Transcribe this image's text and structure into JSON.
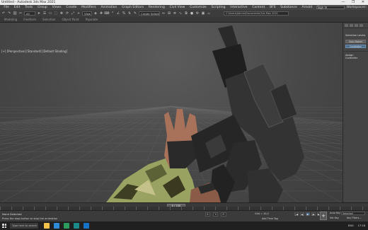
{
  "window": {
    "title": "Untitled - Autodesk 3ds Max 2021",
    "controls": [
      "—",
      "❐",
      "✕"
    ]
  },
  "menu": {
    "items": [
      "File",
      "Edit",
      "Tools",
      "Group",
      "Views",
      "Create",
      "Modifiers",
      "Animation",
      "Graph Editors",
      "Rendering",
      "Civil View",
      "Customize",
      "Scripting",
      "Interactive",
      "Content",
      "BFS",
      "Substance",
      "Arnold",
      "Help"
    ],
    "signin_label": "Sign In",
    "workspaces_label": "Workspaces:"
  },
  "toolbar": {
    "filter_value": "All",
    "view_value": "View",
    "selection_set_value": "Create Selection Set",
    "project_path": "C:\\Users\\Admin\\Documents\\3ds Max 2021"
  },
  "ribbon": {
    "tabs": [
      "Modeling",
      "Freeform",
      "Selection",
      "Object Paint",
      "Populate"
    ]
  },
  "viewport": {
    "label": "[+] [Perspective] [Standard] [Default Shading]",
    "background_color": "#4a4a4a",
    "grid_color": "#6a6a6a"
  },
  "command_panel": {
    "selection_title": "Selection Levels",
    "button_sub": "Sub-Object",
    "button_active": "Controller",
    "rollout": "Assign Controller"
  },
  "timeline": {
    "frame_indicator": "0 / 100"
  },
  "status": {
    "selection": "None Selected",
    "prompt": "Press the stop button to stop the animation",
    "x": "X:",
    "y": "Y:",
    "z": "Z:",
    "grid": "Grid = 10,0",
    "add_time_tag": "Add Time Tag",
    "autokey": "Auto Key",
    "selected": "Selected",
    "setkey": "Set Key",
    "key_filters": "Key Filters..."
  },
  "playback": [
    "|◀",
    "◀|",
    "▶",
    "|▶",
    "▶|"
  ],
  "taskbar": {
    "search_placeholder": "Type here to search",
    "app_colors": [
      "#f3c14b",
      "#2e8bd8",
      "#2d9b5b",
      "#1a8a8a",
      "#1572c6"
    ],
    "tray_lang": "ENG",
    "tray_time": "17:18"
  }
}
